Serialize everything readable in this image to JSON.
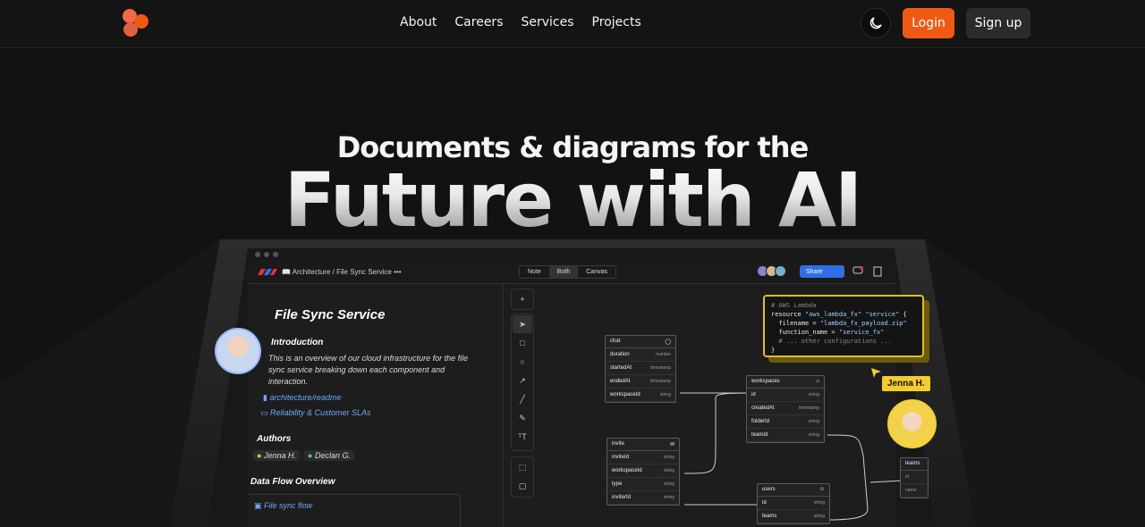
{
  "nav": {
    "links": [
      "About",
      "Careers",
      "Services",
      "Projects"
    ],
    "login_label": "Login",
    "signup_label": "Sign up",
    "brand_colors": {
      "accent": "#ee5a14",
      "bg": "#141414"
    }
  },
  "hero": {
    "line1": "Documents & diagrams for the",
    "line2": "Future with AI"
  },
  "app": {
    "breadcrumb": "📖 Architecture  /  File Sync Service   •••",
    "view_tabs": [
      "Note",
      "Both",
      "Canvas"
    ],
    "share_label": "Share",
    "doc": {
      "title": "File Sync Service",
      "intro_heading": "Introduction",
      "intro_text": "This is an overview of our cloud infrastructure for the file sync service breaking down each component and interaction.",
      "link1": "architecture/readme",
      "link2": "Reliability & Customer SLAs",
      "authors_heading": "Authors",
      "author1": "Jenna H.",
      "author2": "Declan G.",
      "flow_heading": "Data Flow Overview",
      "flow_link": "File sync flow"
    },
    "code": {
      "comment": "# AWS Lambda",
      "line1a": "resource ",
      "line1b": "\"aws_lambda_fx\" \"service\"",
      "line1c": " {",
      "line2a": "  filename = ",
      "line2b": "\"lambda_fx_payload.zip\"",
      "line3a": "  function_name = ",
      "line3b": "\"service_fx\"",
      "line4": "  # ... other configurations ...",
      "line5": "}"
    },
    "cursor_label": "Jenna H.",
    "tables": {
      "chat": {
        "name": "chat",
        "rows": [
          [
            "duration",
            "number"
          ],
          [
            "startedAt",
            "timestamp"
          ],
          [
            "endedAt",
            "timestamp"
          ],
          [
            "workspaceId",
            "string"
          ]
        ]
      },
      "workspaces": {
        "name": "workspaces",
        "rows": [
          [
            "id",
            "string"
          ],
          [
            "createdAt",
            "timestamp"
          ],
          [
            "folderId",
            "string"
          ],
          [
            "teamId",
            "string"
          ]
        ]
      },
      "invite": {
        "name": "invite",
        "rows": [
          [
            "inviteId",
            "string"
          ],
          [
            "workspaceId",
            "string"
          ],
          [
            "type",
            "string"
          ],
          [
            "inviterId",
            "string"
          ]
        ]
      },
      "users": {
        "name": "users",
        "rows": [
          [
            "id",
            "string"
          ],
          [
            "teams",
            "string"
          ]
        ]
      },
      "teams": {
        "name": "teams",
        "rows": [
          [
            "id",
            ""
          ],
          [
            "name",
            ""
          ]
        ]
      }
    }
  }
}
